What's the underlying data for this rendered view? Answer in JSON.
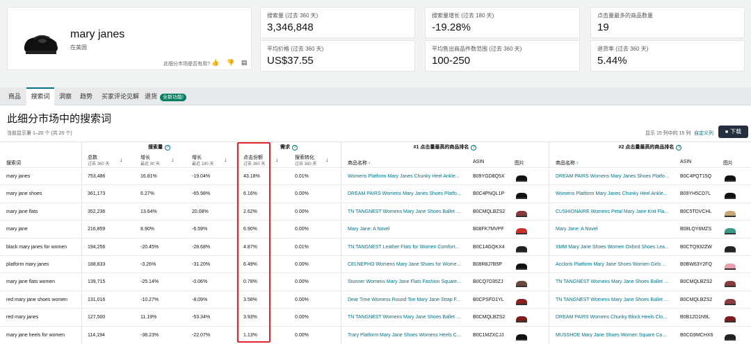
{
  "product": {
    "name": "mary janes",
    "region": "在美国",
    "feedback_question": "此细分市场是否有用?"
  },
  "metrics": [
    {
      "label": "搜索量 (过去 360 天)",
      "value": "3,346,848"
    },
    {
      "label": "搜索量增长 (过去 180 天)",
      "value": "-19.28%"
    },
    {
      "label": "点击量最多的商品数量",
      "value": "19"
    },
    {
      "label": "平均价格 (过去 360 天)",
      "value": "US$37.55"
    },
    {
      "label": "平均售出商品件数范围 (过去 360 天)",
      "value": "100-250"
    },
    {
      "label": "退货率 (过去 360 天)",
      "value": "5.44%"
    }
  ],
  "tabs": [
    {
      "label": "商品"
    },
    {
      "label": "搜索词"
    },
    {
      "label": "洞察"
    },
    {
      "label": "趋势"
    },
    {
      "label": "买家评论见解"
    },
    {
      "label": "退货"
    }
  ],
  "tab_badge": "全新功能!",
  "section_title": "此细分市场中的搜索词",
  "showing": "当前显示第 1–20 个 (共 20 个)",
  "showing_cols": "显示 15 列中的 15 列",
  "customize": "自定义列",
  "download": "下载",
  "groups": {
    "volume": "搜索量",
    "demand": "需求",
    "top1": "#1 点击量最高的商品排名",
    "top2": "#2 点击量最高的商品排名"
  },
  "columns": {
    "term": "搜索词",
    "total": "总数",
    "total_sub": "过去 360 天",
    "growth90": "增长",
    "growth90_sub": "最近 90 天",
    "growth180": "增长",
    "growth180_sub": "最近 180 天",
    "click_share": "点击份额",
    "click_share_sub": "过去 360 天",
    "conversion": "搜索转化",
    "conversion_sub": "过去 360 天",
    "pname": "商品名称",
    "asin": "ASIN",
    "image": "图片"
  },
  "rows": [
    {
      "term": "mary janes",
      "total": "753,486",
      "g90": "16.81%",
      "g180": "-19.04%",
      "click": "43.18%",
      "conv": "0.01%",
      "p1": "Womens Platform Mary Janes Chunky Heel Ankle...",
      "a1": "B09YGD8Q5X",
      "p2": "DREAM PAIRS Womens Mary Janes Shoes Platfor...",
      "a2": "B0C4PQT15Q"
    },
    {
      "term": "mary jane shoes",
      "total": "361,173",
      "g90": "6.27%",
      "g180": "-65.98%",
      "click": "6.16%",
      "conv": "0.00%",
      "p1": "DREAM PAIRS Womens Mary Janes Shoes Platfor...",
      "a1": "B0C4PNQL1P",
      "p2": "Womens Platform Mary Janes Chunky Heel Ankle...",
      "a2": "B09YH5CD7L"
    },
    {
      "term": "mary jane flats",
      "total": "352,236",
      "g90": "13.64%",
      "g180": "20.08%",
      "click": "2.62%",
      "conv": "0.00%",
      "p1": "TN TANGNEST Womens Mary Jane Shoes Ballet F...",
      "a1": "B0CMQLBZS2",
      "p2": "CUSHIONAIRE Womens Petal Mary Jane Knit Flat...",
      "a2": "B0C5TDVCHL"
    },
    {
      "term": "mary jane",
      "total": "216,859",
      "g90": "8.90%",
      "g180": "-6.59%",
      "click": "6.90%",
      "conv": "0.00%",
      "p1": "Mary Jane: A Novel",
      "a1": "B08FK7MVPF",
      "p2": "Mary Jane: A Novel",
      "a2": "B08LQY6MZS"
    },
    {
      "term": "black mary janes for women",
      "total": "194,256",
      "g90": "-20.45%",
      "g180": "-28.68%",
      "click": "4.87%",
      "conv": "0.01%",
      "p1": "TN TANGNEST Leather Flats for Women Comfort...",
      "a1": "B0C14GQKX4",
      "p2": "XMM Mary Jane Shoes Women Oxford Shoes Lea...",
      "a2": "B0CTQ932ZW"
    },
    {
      "term": "platform mary janes",
      "total": "188,833",
      "g90": "-3.26%",
      "g180": "-31.20%",
      "click": "6.49%",
      "conv": "0.00%",
      "p1": "CELNEPHO Womens Mary Jane Shoes for Wome...",
      "a1": "B08R8J7B5P",
      "p2": "Accloris Platform Mary Jane Shoes Women Girls ...",
      "a2": "B0BW63Y2FQ"
    },
    {
      "term": "mary jane flats women",
      "total": "139,715",
      "g90": "-25.14%",
      "g180": "-0.06%",
      "click": "0.78%",
      "conv": "0.00%",
      "p1": "Stunner Womens Mary Jane Flats Fashion Square...",
      "a1": "B0CQ7D35ZJ",
      "p2": "TN TANGNEST Womens Mary Jane Shoes Ballet F...",
      "a2": "B0CMQLBZS2"
    },
    {
      "term": "red mary jane shoes women",
      "total": "131,016",
      "g90": "-10.27%",
      "g180": "-8.09%",
      "click": "3.58%",
      "conv": "0.00%",
      "p1": "Dear Time Womens Round Toe Mary Jane Strap F...",
      "a1": "B0CPSFD1YL",
      "p2": "TN TANGNEST Womens Mary Jane Shoes Ballet F...",
      "a2": "B0CMQLBZS2"
    },
    {
      "term": "red mary janes",
      "total": "127,500",
      "g90": "11.19%",
      "g180": "-53.34%",
      "click": "3.93%",
      "conv": "0.00%",
      "p1": "TN TANGNEST Womens Mary Jane Shoes Ballet F...",
      "a1": "B0CMQLBZS2",
      "p2": "DREAM PAIRS Womens Chunky Block Heels Close...",
      "a2": "B0B12D1N9L"
    },
    {
      "term": "mary jane heels for women",
      "total": "114,194",
      "g90": "-38.23%",
      "g180": "-22.07%",
      "click": "1.13%",
      "conv": "0.00%",
      "p1": "Trary Platform Mary Jane Shoes Womens Heels C...",
      "a1": "B0C1MZXCJJ",
      "p2": "MUSSHOE Mary Jane Shoes Women Square Cap ...",
      "a2": "B0CG9MCHX6"
    }
  ]
}
